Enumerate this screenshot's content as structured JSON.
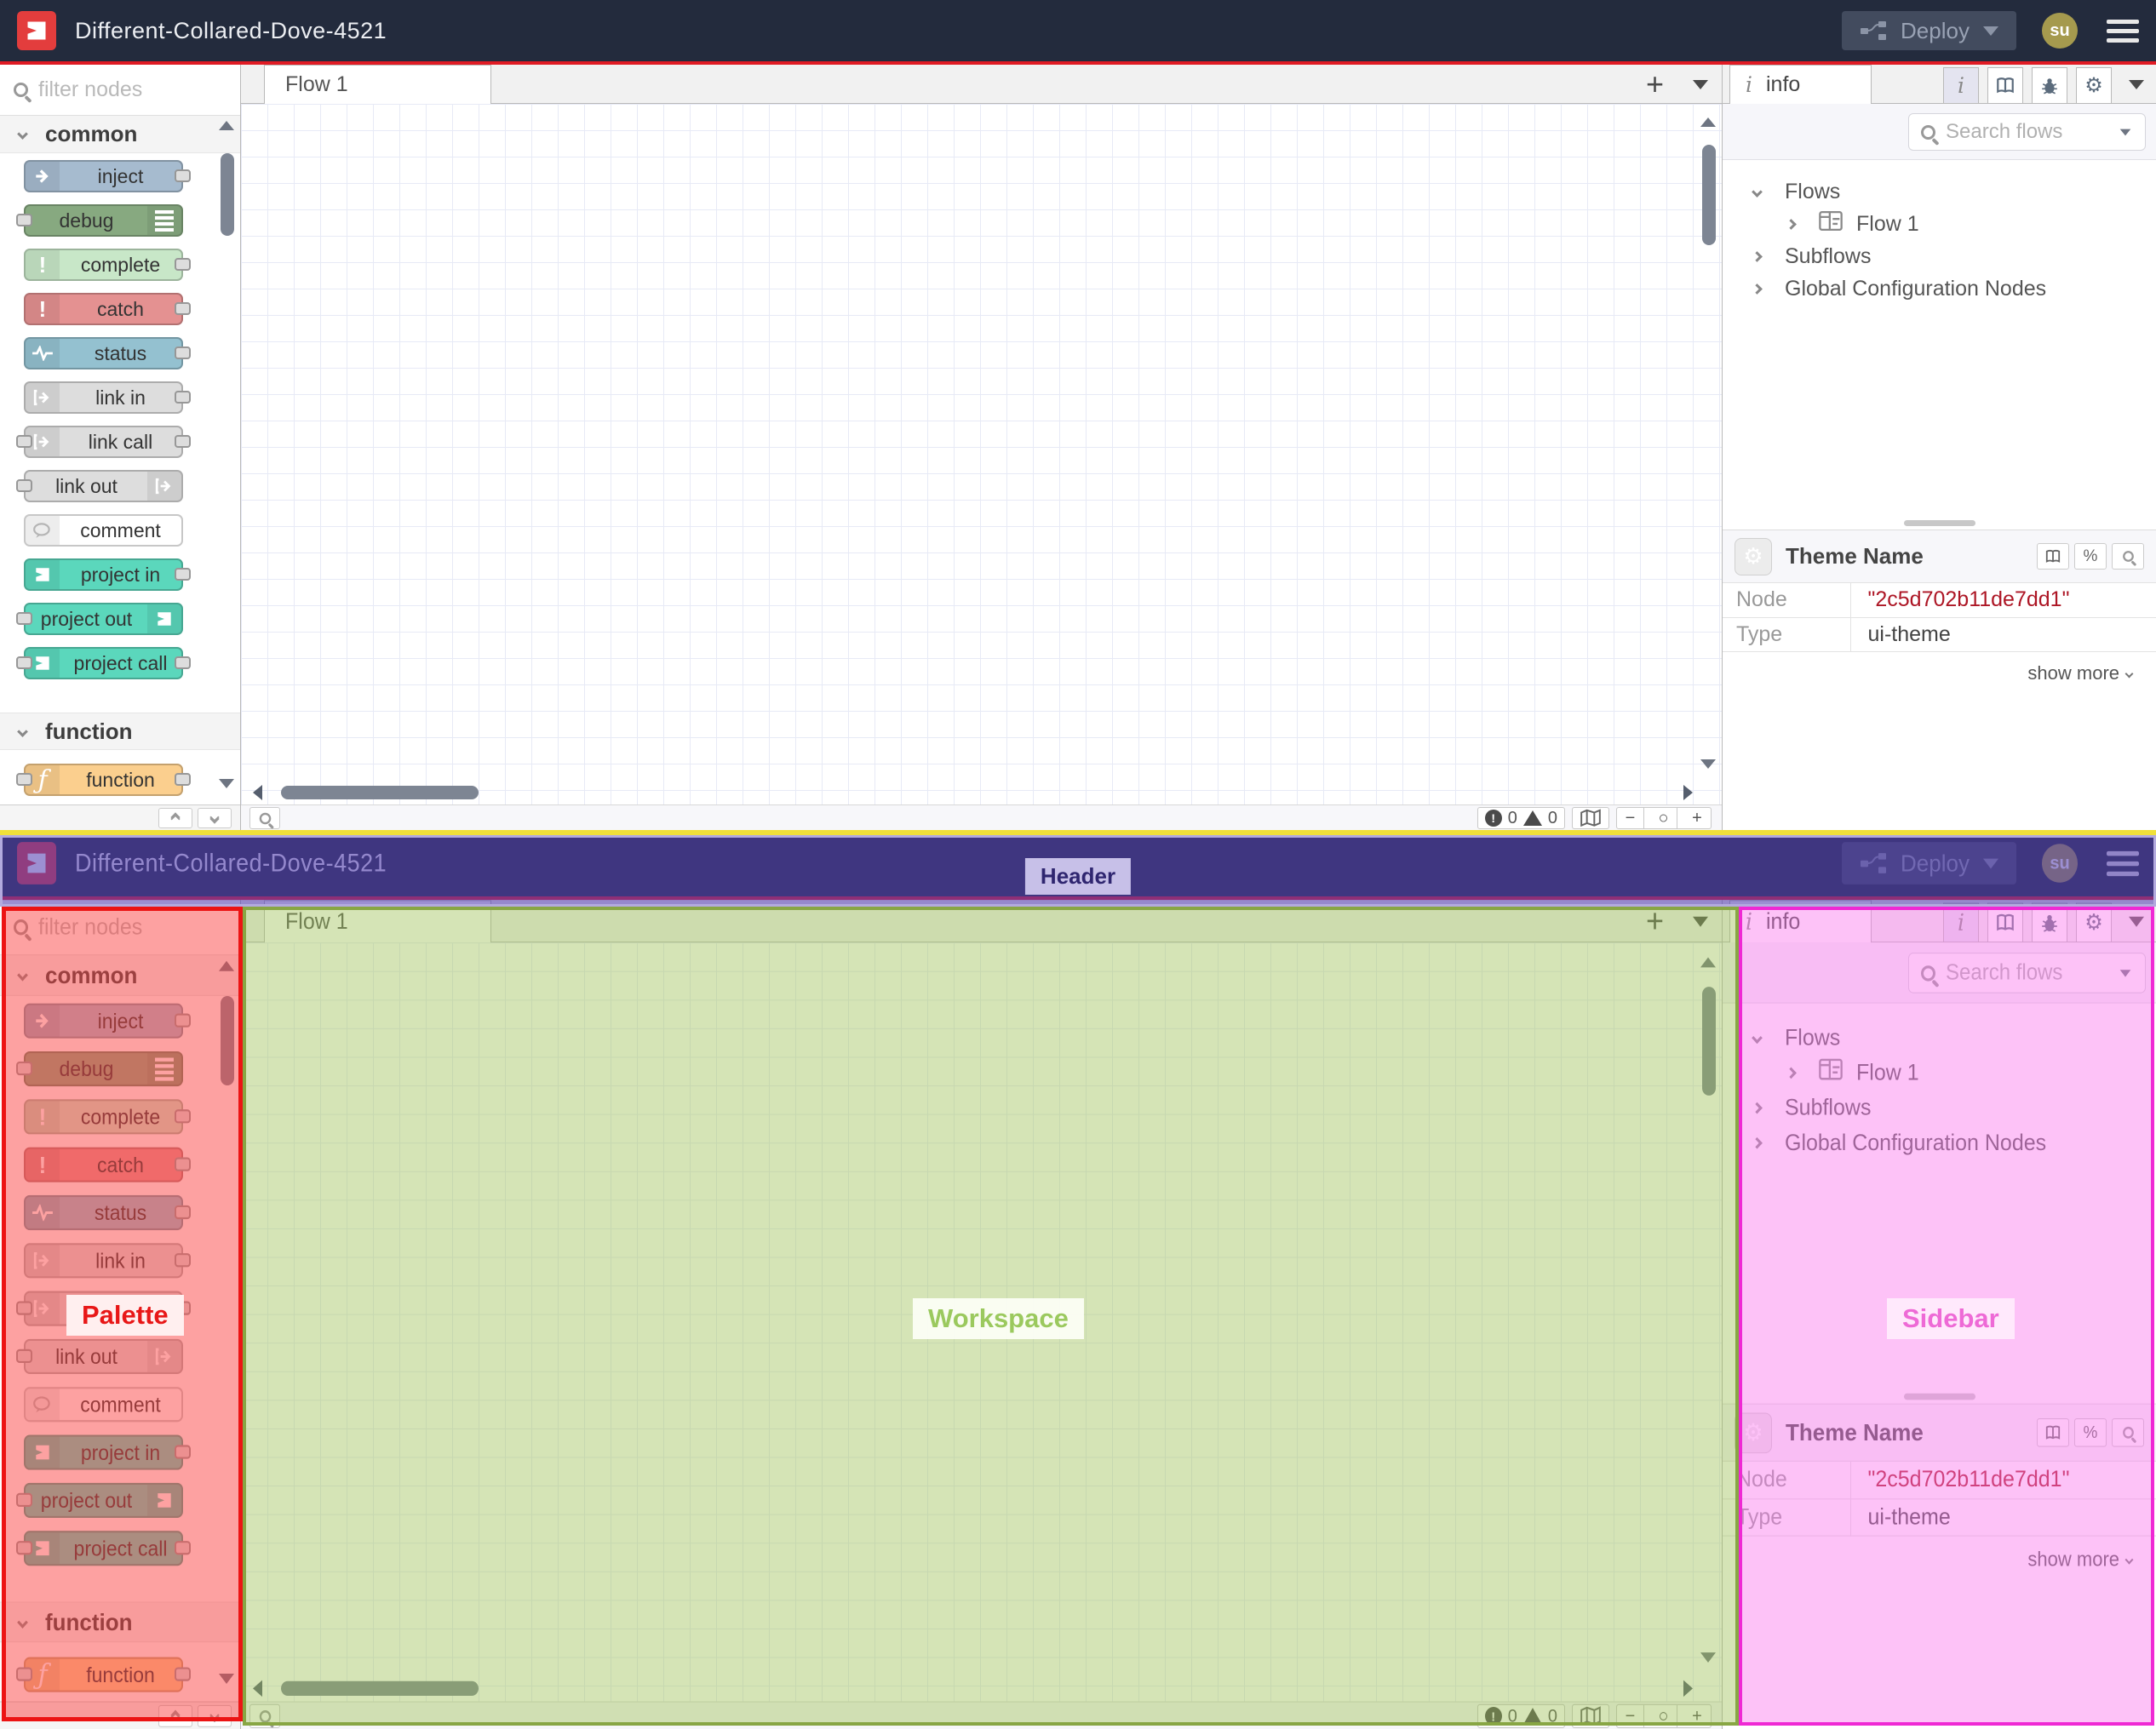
{
  "header": {
    "title": "Different-Collared-Dove-4521",
    "deploy_label": "Deploy",
    "avatar_text": "su"
  },
  "palette": {
    "filter_placeholder": "filter nodes",
    "categories": [
      "common",
      "function"
    ],
    "common_nodes": [
      {
        "label": "inject"
      },
      {
        "label": "debug"
      },
      {
        "label": "complete"
      },
      {
        "label": "catch"
      },
      {
        "label": "status"
      },
      {
        "label": "link in"
      },
      {
        "label": "link call"
      },
      {
        "label": "link out"
      },
      {
        "label": "comment"
      },
      {
        "label": "project in"
      },
      {
        "label": "project out"
      },
      {
        "label": "project call"
      }
    ],
    "function_nodes": [
      {
        "label": "function"
      }
    ]
  },
  "workspace": {
    "tab_label": "Flow 1",
    "add_tab_label": "+",
    "error_count": "0",
    "warning_count": "0",
    "zoom_out": "−",
    "zoom_reset": "○",
    "zoom_in": "+"
  },
  "sidebar": {
    "tab_label": "info",
    "search_placeholder": "Search flows",
    "tree": {
      "flows_label": "Flows",
      "flow1_label": "Flow 1",
      "subflows_label": "Subflows",
      "global_label": "Global Configuration Nodes"
    },
    "panel": {
      "title": "Theme Name",
      "node_label": "Node",
      "node_value": "\"2c5d702b11de7dd1\"",
      "type_label": "Type",
      "type_value": "ui-theme",
      "show_more": "show more",
      "link_icon_glyph": "%"
    }
  },
  "annotations": {
    "header_label": "Header",
    "palette_label": "Palette",
    "workspace_label": "Workspace",
    "sidebar_label": "Sidebar"
  },
  "icons": {
    "bang": "!",
    "gear": "⚙",
    "info_i": "i",
    "function_f": "ƒ"
  },
  "colors": {
    "header_bg": "#232b3d",
    "accent_red": "#e01b24",
    "logo_red": "#e33d3d",
    "node_id_red": "#ad1625",
    "annotation_header": "#b3aade",
    "annotation_palette": "#ec1414",
    "annotation_workspace": "#88a644",
    "annotation_sidebar": "#ef28d4",
    "annotation_topline": "#f0e03a"
  },
  "node_colors": {
    "inject": "#a6bbcf",
    "debug": "#87a980",
    "complete": "#c8e7c8",
    "catch": "#e49191",
    "status": "#94c1d0",
    "link": "#dddddd",
    "comment": "#ffffff",
    "project": "#5bd7bc",
    "function": "#fbcf8e"
  }
}
